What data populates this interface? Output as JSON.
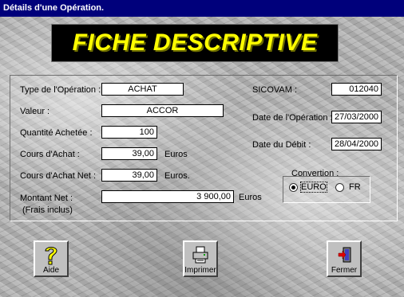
{
  "window": {
    "title": "Détails d'une Opération."
  },
  "banner": {
    "text": "FICHE DESCRIPTIVE"
  },
  "form": {
    "type_label": "Type de l'Opération :",
    "type_value": "ACHAT",
    "valeur_label": "Valeur :",
    "valeur_value": "ACCOR",
    "quantite_label": "Quantité Achetée :",
    "quantite_value": "100",
    "cours_label": "Cours d'Achat :",
    "cours_value": "39,00",
    "cours_unit": "Euros",
    "cours_net_label": "Cours d'Achat Net :",
    "cours_net_value": "39,00",
    "cours_net_unit": "Euros.",
    "montant_label": "Montant Net :",
    "montant_sublabel": "(Frais inclus)",
    "montant_value": "3 900,00",
    "montant_unit": "Euros",
    "sicovam_label": "SICOVAM :",
    "sicovam_value": "012040",
    "date_op_label": "Date de l'Opération :",
    "date_op_value": "27/03/2000",
    "date_debit_label": "Date du Débit :",
    "date_debit_value": "28/04/2000"
  },
  "conversion": {
    "title": "Convertion :",
    "options": [
      "EURO",
      "FR"
    ],
    "selected": "EURO"
  },
  "buttons": {
    "aide": "Aide",
    "imprimer": "Imprimer",
    "fermer": "Fermer"
  },
  "icons": [
    "question-icon",
    "printer-icon",
    "exit-door-icon"
  ]
}
